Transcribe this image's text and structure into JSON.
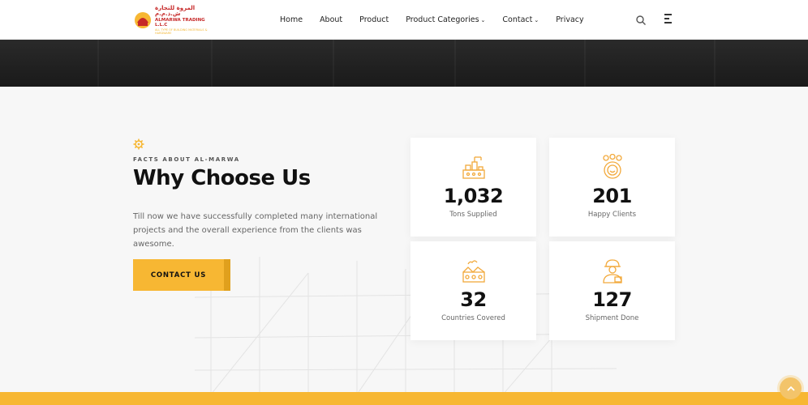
{
  "header": {
    "logo": {
      "arabic": "المروة للتجارة ش.ذ.م.م",
      "english": "ALMARWA TRADING L.L.C",
      "tagline": "ALL TYPE OF BUILDING MATERIALS & HARDWARE"
    },
    "nav": [
      {
        "label": "Home",
        "dropdown": false
      },
      {
        "label": "About",
        "dropdown": false
      },
      {
        "label": "Product",
        "dropdown": false
      },
      {
        "label": "Product Categories",
        "dropdown": true
      },
      {
        "label": "Contact",
        "dropdown": true
      },
      {
        "label": "Privacy",
        "dropdown": false
      }
    ]
  },
  "section": {
    "eyebrow": "FACTS ABOUT AL-MARWA",
    "title": "Why Choose Us",
    "description": "Till now we have successfully completed many international projects and the overall experience from the clients was awesome.",
    "cta_label": "CONTACT US"
  },
  "stats": [
    {
      "value": "1,032",
      "label": "Tons Supplied",
      "icon": "factory-icon"
    },
    {
      "value": "201",
      "label": "Happy Clients",
      "icon": "happy-client-icon"
    },
    {
      "value": "32",
      "label": "Countries Covered",
      "icon": "industry-icon"
    },
    {
      "value": "127",
      "label": "Shipment Done",
      "icon": "worker-icon"
    }
  ],
  "colors": {
    "accent": "#f7b733",
    "accent_dark": "#e0a01d",
    "brand_red": "#c62828",
    "dark_band": "#1f1f1f"
  }
}
